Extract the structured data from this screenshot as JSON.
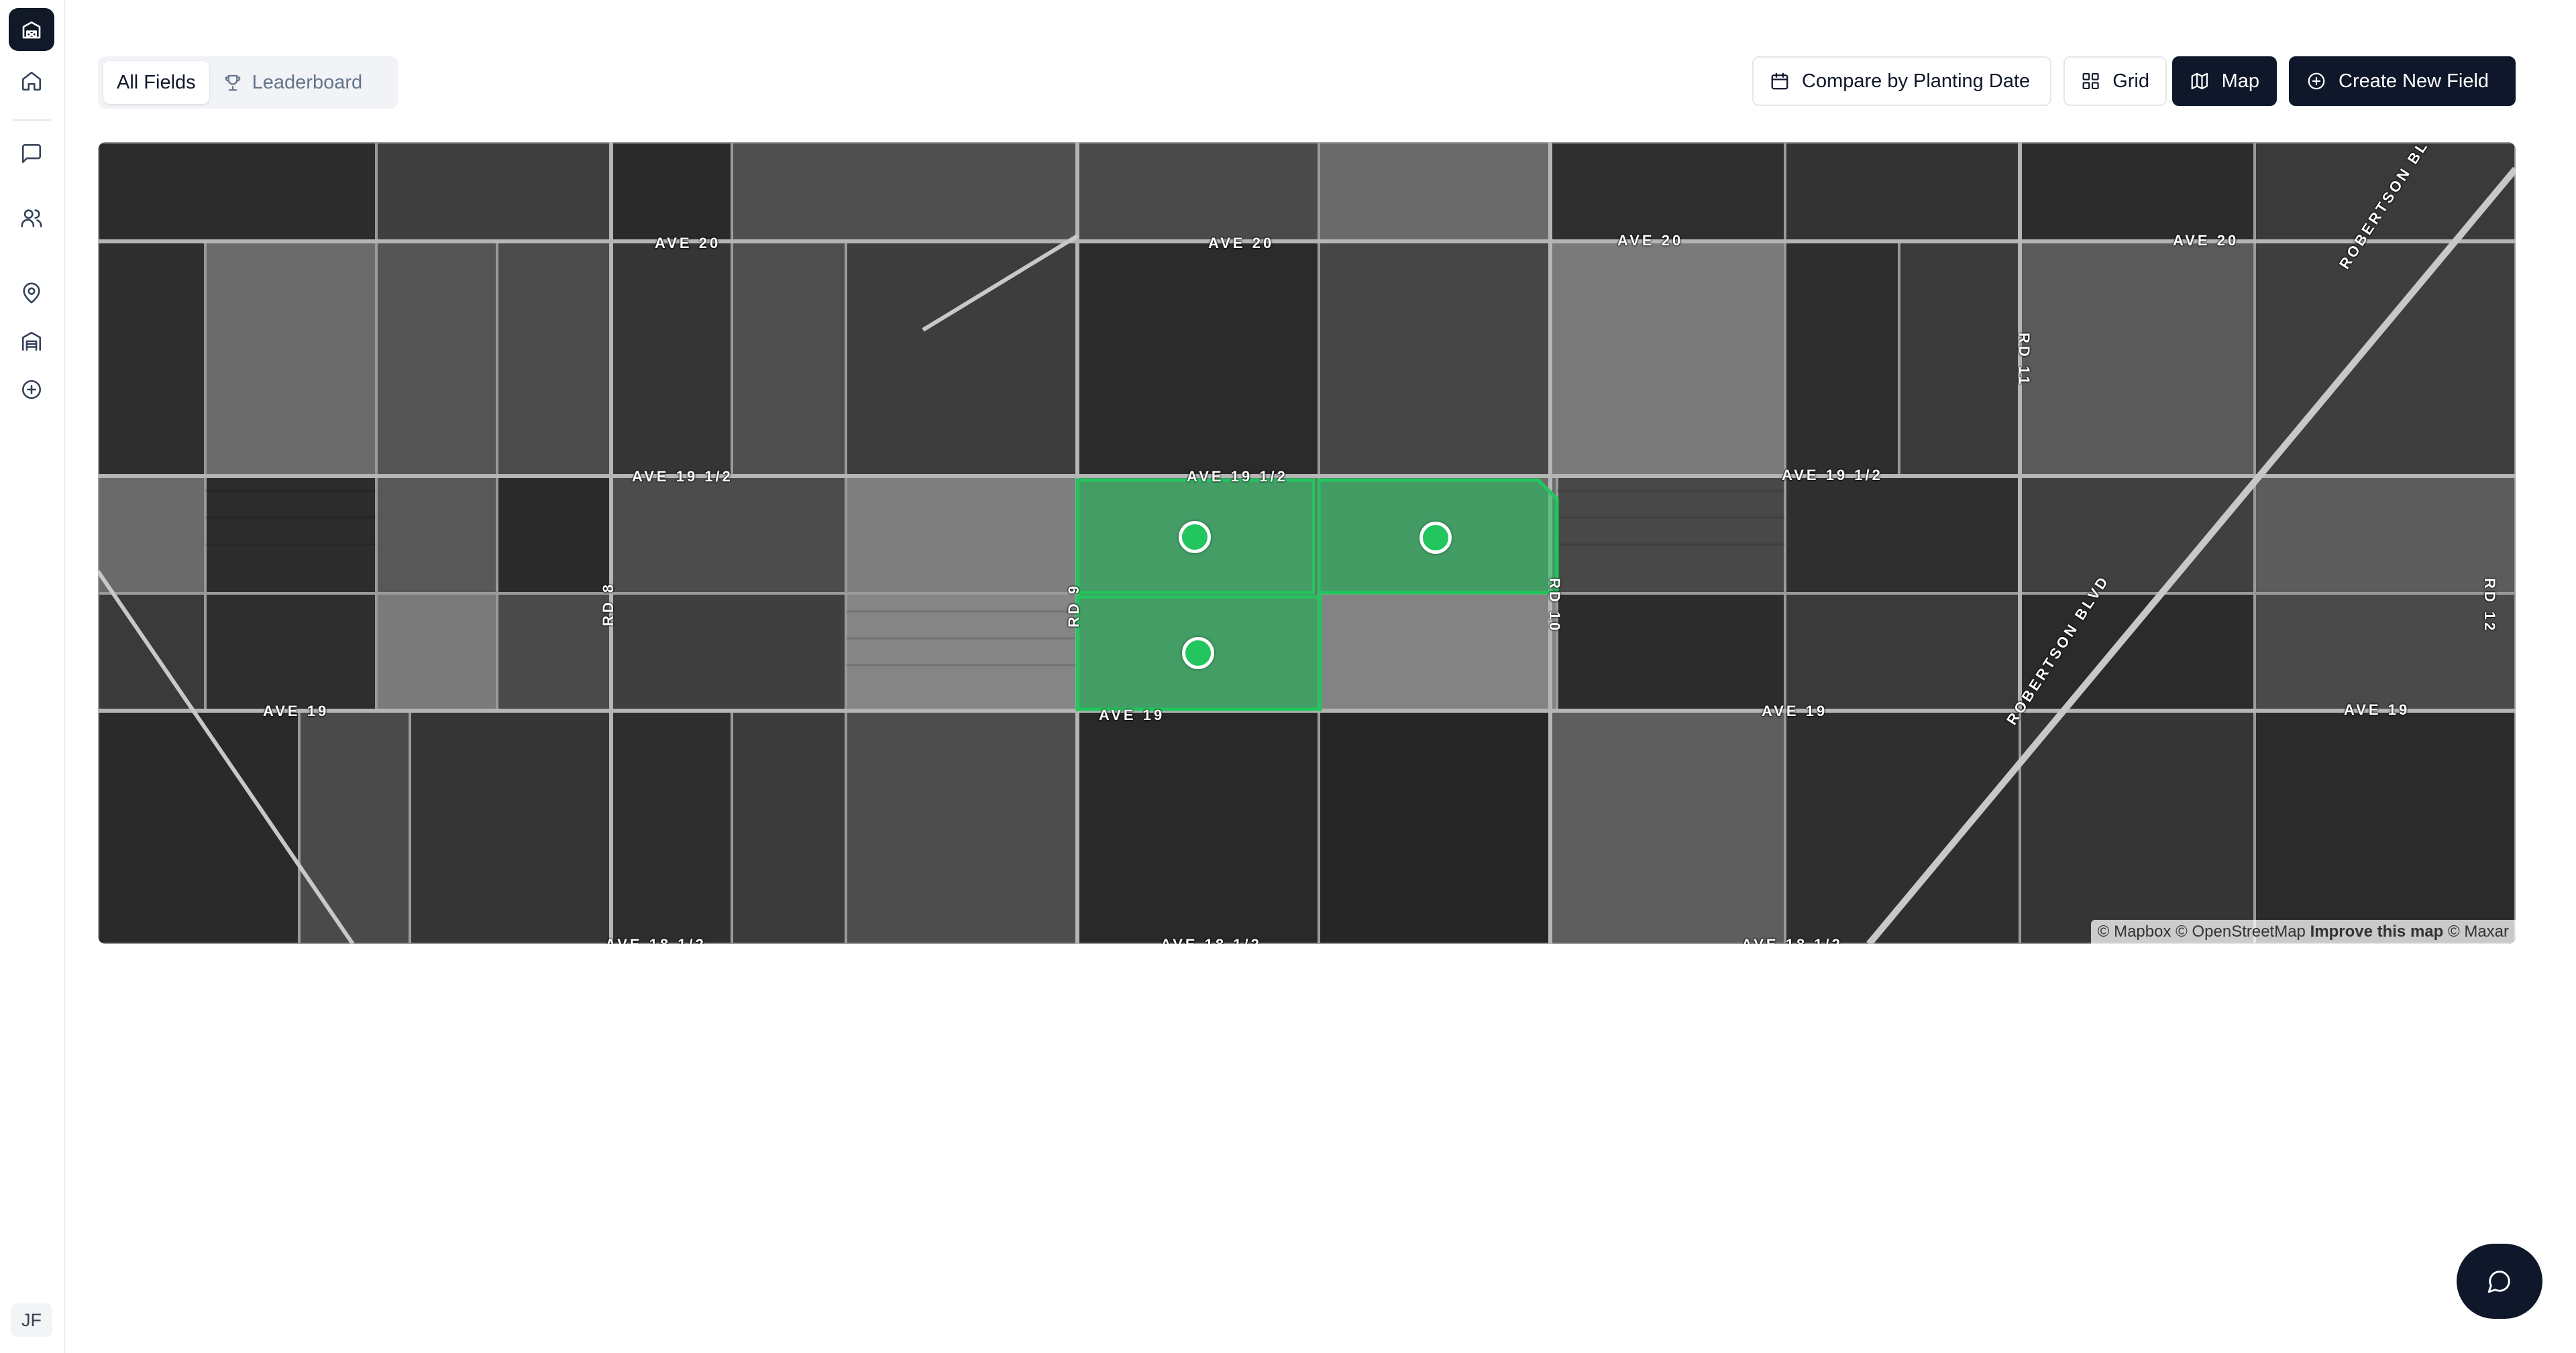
{
  "sidebar": {
    "logo_icon": "barn-icon",
    "items": [
      {
        "icon": "home-icon"
      },
      {
        "icon": "message-icon"
      },
      {
        "icon": "users-icon"
      },
      {
        "icon": "map-pin-icon"
      },
      {
        "icon": "warehouse-icon"
      },
      {
        "icon": "plus-circle-icon"
      }
    ],
    "avatar_initials": "JF"
  },
  "tabs": [
    {
      "label": "All Fields",
      "active": true
    },
    {
      "label": "Leaderboard",
      "active": false,
      "icon": "trophy-icon"
    }
  ],
  "toolbar": {
    "compare_label": "Compare by Planting Date",
    "grid_label": "Grid",
    "map_label": "Map",
    "create_label": "Create New Field",
    "active_view": "Map"
  },
  "map": {
    "road_labels": [
      "AVE 20",
      "AVE 20",
      "AVE 20",
      "AVE 20",
      "AVE 19 1/2",
      "AVE 19 1/2",
      "AVE 19 1/2",
      "AVE 19",
      "AVE 19",
      "AVE 19",
      "AVE 19",
      "AVE 18 1/2",
      "AVE 18 1/2",
      "AVE 18 1/2",
      "RD 8",
      "RD 9",
      "RD 10",
      "RD 11",
      "RD 12",
      "ROBERTSON BLVD",
      "ROBERTSON BL"
    ],
    "attribution": {
      "mapbox": "© Mapbox",
      "osm": "© OpenStreetMap",
      "improve": "Improve this map",
      "maxar": "© Maxar"
    },
    "field_color": "#22c55e"
  },
  "colors": {
    "accent": "#0f172a",
    "field_green": "#22c55e"
  }
}
